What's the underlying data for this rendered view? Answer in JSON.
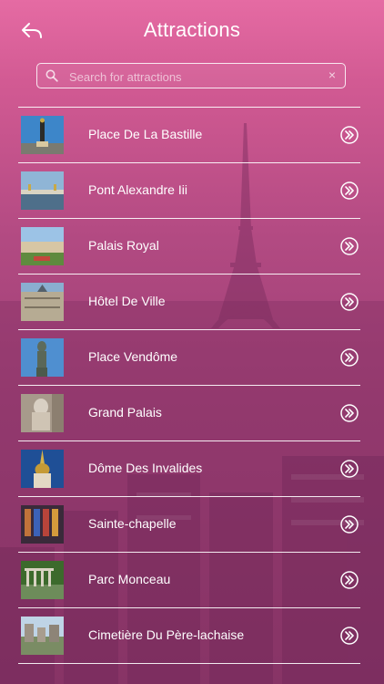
{
  "header": {
    "title": "Attractions",
    "back_icon": "back-arrow-icon"
  },
  "search": {
    "placeholder": "Search for attractions",
    "value": "",
    "icon": "search-icon",
    "clear_icon": "clear-icon",
    "clear_label": "×"
  },
  "list": {
    "items": [
      {
        "label": "Place De La Bastille"
      },
      {
        "label": "Pont Alexandre Iii"
      },
      {
        "label": "Palais Royal"
      },
      {
        "label": "Hôtel De Ville"
      },
      {
        "label": "Place Vendôme"
      },
      {
        "label": "Grand Palais"
      },
      {
        "label": "Dôme Des Invalides"
      },
      {
        "label": "Sainte-chapelle"
      },
      {
        "label": "Parc Monceau"
      },
      {
        "label": "Cimetière Du Père-lachaise"
      }
    ],
    "row_icon": "chevron-double-right-icon"
  },
  "colors": {
    "background_top": "#e56ba3",
    "background_bottom": "#8d3869",
    "text": "#ffffff"
  }
}
